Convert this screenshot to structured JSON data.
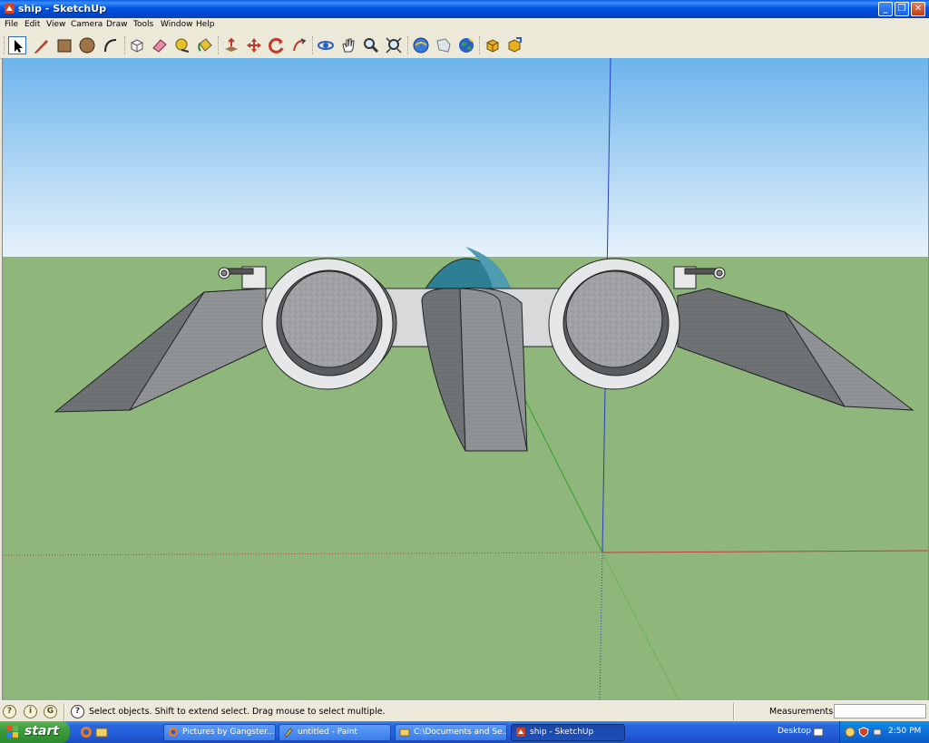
{
  "window": {
    "title": "ship - SketchUp",
    "controls": [
      "_",
      "❐",
      "✕"
    ]
  },
  "menu": [
    "File",
    "Edit",
    "View",
    "Camera",
    "Draw",
    "Tools",
    "Window",
    "Help"
  ],
  "toolbar": {
    "tools": [
      {
        "name": "select",
        "icon": "select-arrow-icon",
        "selected": true
      },
      {
        "name": "line",
        "icon": "pencil-icon"
      },
      {
        "name": "rectangle",
        "icon": "rectangle-icon"
      },
      {
        "name": "circle",
        "icon": "circle-icon"
      },
      {
        "name": "arc",
        "icon": "arc-icon"
      },
      {
        "name": "make-component",
        "icon": "component-icon"
      },
      {
        "name": "eraser",
        "icon": "eraser-icon"
      },
      {
        "name": "tape-measure",
        "icon": "tape-measure-icon"
      },
      {
        "name": "paint-bucket",
        "icon": "paint-bucket-icon"
      },
      {
        "name": "push-pull",
        "icon": "push-pull-icon"
      },
      {
        "name": "move",
        "icon": "move-icon"
      },
      {
        "name": "rotate",
        "icon": "rotate-icon"
      },
      {
        "name": "follow-me",
        "icon": "follow-me-icon"
      },
      {
        "name": "orbit",
        "icon": "orbit-icon"
      },
      {
        "name": "pan",
        "icon": "pan-hand-icon"
      },
      {
        "name": "zoom",
        "icon": "zoom-icon"
      },
      {
        "name": "zoom-extents",
        "icon": "zoom-extents-icon"
      },
      {
        "name": "get-models",
        "icon": "get-models-icon"
      },
      {
        "name": "share-model",
        "icon": "share-model-icon"
      },
      {
        "name": "google-earth",
        "icon": "google-earth-icon"
      },
      {
        "name": "components-get",
        "icon": "components-get-icon"
      },
      {
        "name": "components-share",
        "icon": "components-share-icon"
      }
    ]
  },
  "viewport": {
    "sky_color": "#a7d1f0",
    "ground_color": "#8fb77c",
    "axis_colors": {
      "red": "#c43c3c",
      "green": "#2fa02f",
      "blue": "#2a3fc4"
    }
  },
  "status": {
    "hint": "Select objects. Shift to extend select. Drag mouse to select multiple.",
    "measurements_label": "Measurements",
    "measurements_value": ""
  },
  "taskbar": {
    "start_label": "start",
    "buttons": [
      {
        "label": "Pictures by Gangster...",
        "icon": "firefox-icon",
        "active": false
      },
      {
        "label": "untitled - Paint",
        "icon": "paint-icon",
        "active": false
      },
      {
        "label": "C:\\Documents and Se...",
        "icon": "folder-icon",
        "active": false
      },
      {
        "label": "ship - SketchUp",
        "icon": "sketchup-icon",
        "active": true
      }
    ],
    "desktop_label": "Desktop",
    "clock": "2:50 PM"
  }
}
